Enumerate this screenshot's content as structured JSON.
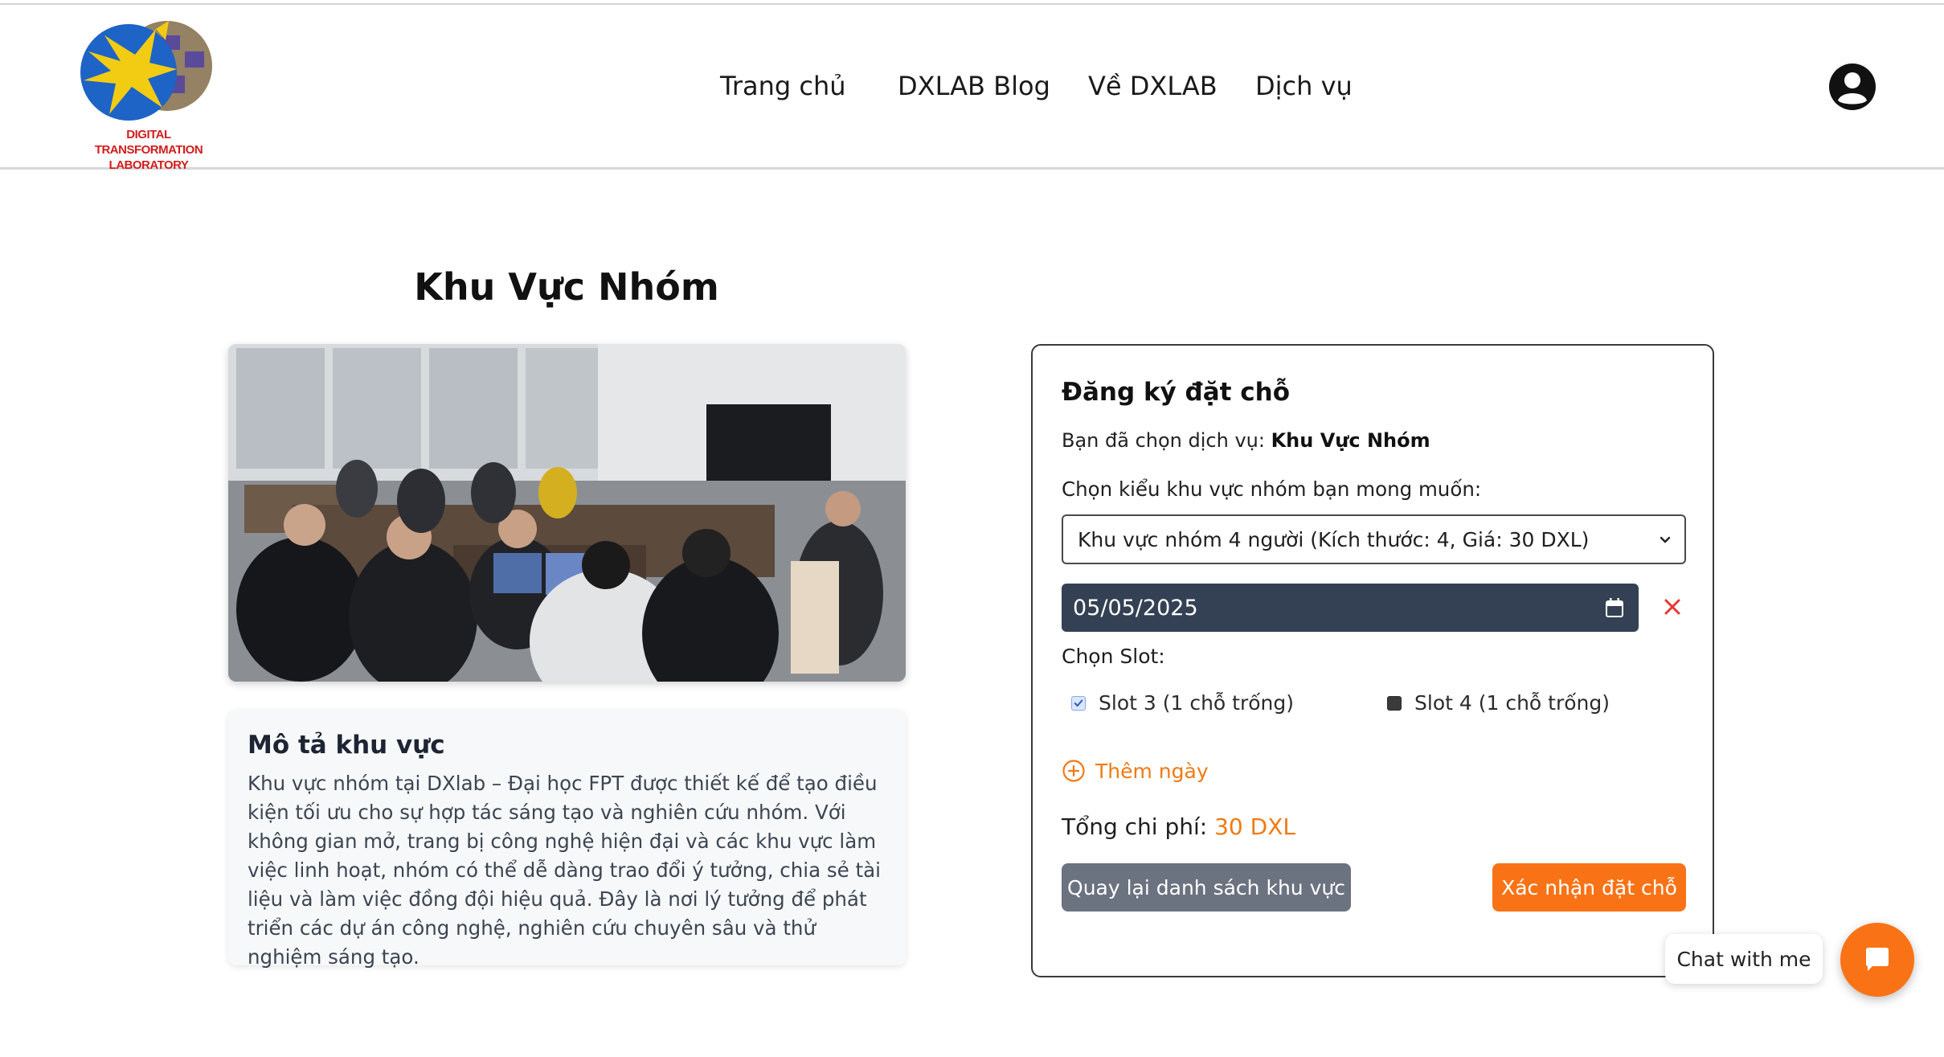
{
  "header": {
    "logo_text": "DIGITAL TRANSFORMATION\nLABORATORY",
    "nav": [
      {
        "label": "Trang chủ"
      },
      {
        "label": "DXLAB Blog"
      },
      {
        "label": "Về DXLAB"
      },
      {
        "label": "Dịch vụ"
      }
    ],
    "user_icon": "user-circle-icon"
  },
  "main": {
    "title": "Khu Vực Nhóm",
    "photo_icon": "group-work-photo",
    "description": {
      "heading": "Mô tả khu vực",
      "text": "Khu vực nhóm tại DXlab – Đại học FPT được thiết kế để tạo điều kiện tối ưu cho sự hợp tác sáng tạo và nghiên cứu nhóm. Với không gian mở, trang bị công nghệ hiện đại và các khu vực làm việc linh hoạt, nhóm có thể dễ dàng trao đổi ý tưởng, chia sẻ tài liệu và làm việc đồng đội hiệu quả. Đây là nơi lý tưởng để phát triển các dự án công nghệ, nghiên cứu chuyên sâu và thử nghiệm sáng tạo."
    }
  },
  "booking": {
    "title": "Đăng ký đặt chỗ",
    "chosen_prefix": "Bạn đã chọn dịch vụ: ",
    "chosen_service": "Khu Vực Nhóm",
    "area_label": "Chọn kiểu khu vực nhóm bạn mong muốn:",
    "area_selected": "Khu vực nhóm 4 người (Kích thước: 4, Giá: 30 DXL)",
    "date_value": "05/05/2025",
    "slot_label": "Chọn Slot:",
    "slots": [
      {
        "label": "Slot 3 (1 chỗ trống)",
        "checked": true
      },
      {
        "label": "Slot 4 (1 chỗ trống)",
        "checked": false
      }
    ],
    "add_day": "Thêm ngày",
    "total_label": "Tổng chi phí: ",
    "total_value": "30 DXL",
    "back_button": "Quay lại danh sách khu vực",
    "confirm_button": "Xác nhận đặt chỗ"
  },
  "chat": {
    "label": "Chat with me"
  },
  "colors": {
    "accent": "#f97316",
    "date_bg": "#344154",
    "back_button_bg": "#6b7280",
    "remove_icon": "#e53935"
  }
}
